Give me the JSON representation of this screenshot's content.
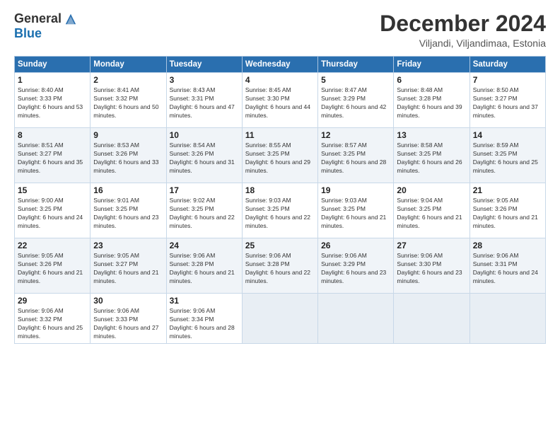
{
  "header": {
    "logo_general": "General",
    "logo_blue": "Blue",
    "month_title": "December 2024",
    "location": "Viljandi, Viljandimaa, Estonia"
  },
  "days_of_week": [
    "Sunday",
    "Monday",
    "Tuesday",
    "Wednesday",
    "Thursday",
    "Friday",
    "Saturday"
  ],
  "weeks": [
    [
      {
        "day": "1",
        "sunrise": "Sunrise: 8:40 AM",
        "sunset": "Sunset: 3:33 PM",
        "daylight": "Daylight: 6 hours and 53 minutes."
      },
      {
        "day": "2",
        "sunrise": "Sunrise: 8:41 AM",
        "sunset": "Sunset: 3:32 PM",
        "daylight": "Daylight: 6 hours and 50 minutes."
      },
      {
        "day": "3",
        "sunrise": "Sunrise: 8:43 AM",
        "sunset": "Sunset: 3:31 PM",
        "daylight": "Daylight: 6 hours and 47 minutes."
      },
      {
        "day": "4",
        "sunrise": "Sunrise: 8:45 AM",
        "sunset": "Sunset: 3:30 PM",
        "daylight": "Daylight: 6 hours and 44 minutes."
      },
      {
        "day": "5",
        "sunrise": "Sunrise: 8:47 AM",
        "sunset": "Sunset: 3:29 PM",
        "daylight": "Daylight: 6 hours and 42 minutes."
      },
      {
        "day": "6",
        "sunrise": "Sunrise: 8:48 AM",
        "sunset": "Sunset: 3:28 PM",
        "daylight": "Daylight: 6 hours and 39 minutes."
      },
      {
        "day": "7",
        "sunrise": "Sunrise: 8:50 AM",
        "sunset": "Sunset: 3:27 PM",
        "daylight": "Daylight: 6 hours and 37 minutes."
      }
    ],
    [
      {
        "day": "8",
        "sunrise": "Sunrise: 8:51 AM",
        "sunset": "Sunset: 3:27 PM",
        "daylight": "Daylight: 6 hours and 35 minutes."
      },
      {
        "day": "9",
        "sunrise": "Sunrise: 8:53 AM",
        "sunset": "Sunset: 3:26 PM",
        "daylight": "Daylight: 6 hours and 33 minutes."
      },
      {
        "day": "10",
        "sunrise": "Sunrise: 8:54 AM",
        "sunset": "Sunset: 3:26 PM",
        "daylight": "Daylight: 6 hours and 31 minutes."
      },
      {
        "day": "11",
        "sunrise": "Sunrise: 8:55 AM",
        "sunset": "Sunset: 3:25 PM",
        "daylight": "Daylight: 6 hours and 29 minutes."
      },
      {
        "day": "12",
        "sunrise": "Sunrise: 8:57 AM",
        "sunset": "Sunset: 3:25 PM",
        "daylight": "Daylight: 6 hours and 28 minutes."
      },
      {
        "day": "13",
        "sunrise": "Sunrise: 8:58 AM",
        "sunset": "Sunset: 3:25 PM",
        "daylight": "Daylight: 6 hours and 26 minutes."
      },
      {
        "day": "14",
        "sunrise": "Sunrise: 8:59 AM",
        "sunset": "Sunset: 3:25 PM",
        "daylight": "Daylight: 6 hours and 25 minutes."
      }
    ],
    [
      {
        "day": "15",
        "sunrise": "Sunrise: 9:00 AM",
        "sunset": "Sunset: 3:25 PM",
        "daylight": "Daylight: 6 hours and 24 minutes."
      },
      {
        "day": "16",
        "sunrise": "Sunrise: 9:01 AM",
        "sunset": "Sunset: 3:25 PM",
        "daylight": "Daylight: 6 hours and 23 minutes."
      },
      {
        "day": "17",
        "sunrise": "Sunrise: 9:02 AM",
        "sunset": "Sunset: 3:25 PM",
        "daylight": "Daylight: 6 hours and 22 minutes."
      },
      {
        "day": "18",
        "sunrise": "Sunrise: 9:03 AM",
        "sunset": "Sunset: 3:25 PM",
        "daylight": "Daylight: 6 hours and 22 minutes."
      },
      {
        "day": "19",
        "sunrise": "Sunrise: 9:03 AM",
        "sunset": "Sunset: 3:25 PM",
        "daylight": "Daylight: 6 hours and 21 minutes."
      },
      {
        "day": "20",
        "sunrise": "Sunrise: 9:04 AM",
        "sunset": "Sunset: 3:25 PM",
        "daylight": "Daylight: 6 hours and 21 minutes."
      },
      {
        "day": "21",
        "sunrise": "Sunrise: 9:05 AM",
        "sunset": "Sunset: 3:26 PM",
        "daylight": "Daylight: 6 hours and 21 minutes."
      }
    ],
    [
      {
        "day": "22",
        "sunrise": "Sunrise: 9:05 AM",
        "sunset": "Sunset: 3:26 PM",
        "daylight": "Daylight: 6 hours and 21 minutes."
      },
      {
        "day": "23",
        "sunrise": "Sunrise: 9:05 AM",
        "sunset": "Sunset: 3:27 PM",
        "daylight": "Daylight: 6 hours and 21 minutes."
      },
      {
        "day": "24",
        "sunrise": "Sunrise: 9:06 AM",
        "sunset": "Sunset: 3:28 PM",
        "daylight": "Daylight: 6 hours and 21 minutes."
      },
      {
        "day": "25",
        "sunrise": "Sunrise: 9:06 AM",
        "sunset": "Sunset: 3:28 PM",
        "daylight": "Daylight: 6 hours and 22 minutes."
      },
      {
        "day": "26",
        "sunrise": "Sunrise: 9:06 AM",
        "sunset": "Sunset: 3:29 PM",
        "daylight": "Daylight: 6 hours and 23 minutes."
      },
      {
        "day": "27",
        "sunrise": "Sunrise: 9:06 AM",
        "sunset": "Sunset: 3:30 PM",
        "daylight": "Daylight: 6 hours and 23 minutes."
      },
      {
        "day": "28",
        "sunrise": "Sunrise: 9:06 AM",
        "sunset": "Sunset: 3:31 PM",
        "daylight": "Daylight: 6 hours and 24 minutes."
      }
    ],
    [
      {
        "day": "29",
        "sunrise": "Sunrise: 9:06 AM",
        "sunset": "Sunset: 3:32 PM",
        "daylight": "Daylight: 6 hours and 25 minutes."
      },
      {
        "day": "30",
        "sunrise": "Sunrise: 9:06 AM",
        "sunset": "Sunset: 3:33 PM",
        "daylight": "Daylight: 6 hours and 27 minutes."
      },
      {
        "day": "31",
        "sunrise": "Sunrise: 9:06 AM",
        "sunset": "Sunset: 3:34 PM",
        "daylight": "Daylight: 6 hours and 28 minutes."
      },
      null,
      null,
      null,
      null
    ]
  ]
}
